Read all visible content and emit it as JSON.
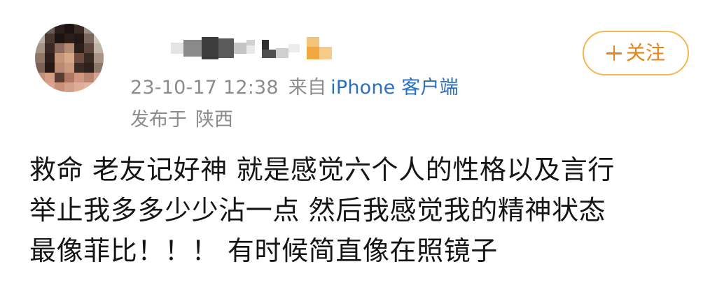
{
  "author": {
    "timestamp": "23-10-17 12:38",
    "source_prefix": "来自",
    "source_link": "iPhone 客户端",
    "location_prefix": "发布于",
    "location": "陕西"
  },
  "follow_button": {
    "label": "关注",
    "icon": "plus-icon",
    "accent_color": "#e8821a",
    "border_color": "#f5b74f"
  },
  "post": {
    "lines": [
      "救命 老友记好神 就是感觉六个人的性格以及言行",
      "举止我多多少少沾一点 然后我感觉我的精神状态",
      "最像菲比！！！ 有时候简直像在照镜子"
    ]
  },
  "colors": {
    "meta_text": "#8c8c8c",
    "link": "#2a6fc0",
    "body_text": "#151515"
  }
}
